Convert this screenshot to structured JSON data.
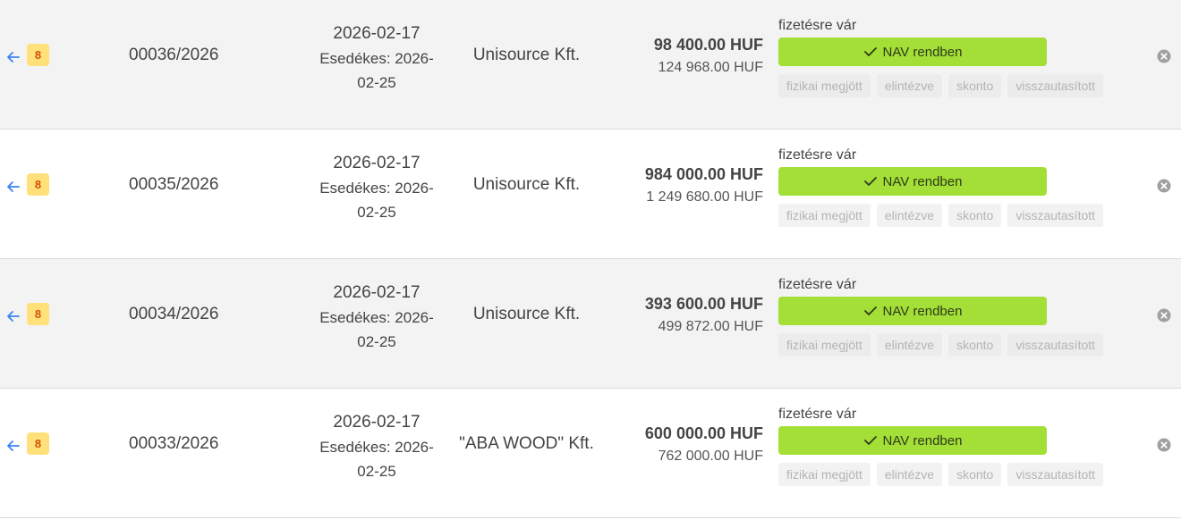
{
  "colors": {
    "badge_bg": "#ffe07a",
    "badge_text": "#d35400",
    "nav_ok": "#a3df36",
    "back_arrow": "#3b82f6",
    "remove_icon": "#a0a0a0"
  },
  "icons": {
    "back": "arrow-left-icon",
    "check": "check-icon",
    "remove": "close-circle-icon"
  },
  "rows": [
    {
      "badge": "8",
      "invoice_no": "00036/2026",
      "issue_date": "2026-02-17",
      "due": "Esedékes: 2026-02-25",
      "partner": "Unisource Kft.",
      "net": "98 400.00 HUF",
      "gross": "124 968.00 HUF",
      "payment_status": "fizetésre vár",
      "nav_status": "NAV rendben",
      "chips": [
        "fizikai megjött",
        "elintézve",
        "skonto",
        "visszautasított"
      ]
    },
    {
      "badge": "8",
      "invoice_no": "00035/2026",
      "issue_date": "2026-02-17",
      "due": "Esedékes: 2026-02-25",
      "partner": "Unisource Kft.",
      "net": "984 000.00 HUF",
      "gross": "1 249 680.00 HUF",
      "payment_status": "fizetésre vár",
      "nav_status": "NAV rendben",
      "chips": [
        "fizikai megjött",
        "elintézve",
        "skonto",
        "visszautasított"
      ]
    },
    {
      "badge": "8",
      "invoice_no": "00034/2026",
      "issue_date": "2026-02-17",
      "due": "Esedékes: 2026-02-25",
      "partner": "Unisource Kft.",
      "net": "393 600.00 HUF",
      "gross": "499 872.00 HUF",
      "payment_status": "fizetésre vár",
      "nav_status": "NAV rendben",
      "chips": [
        "fizikai megjött",
        "elintézve",
        "skonto",
        "visszautasított"
      ]
    },
    {
      "badge": "8",
      "invoice_no": "00033/2026",
      "issue_date": "2026-02-17",
      "due": "Esedékes: 2026-02-25",
      "partner": "\"ABA WOOD\" Kft.",
      "net": "600 000.00 HUF",
      "gross": "762 000.00 HUF",
      "payment_status": "fizetésre vár",
      "nav_status": "NAV rendben",
      "chips": [
        "fizikai megjött",
        "elintézve",
        "skonto",
        "visszautasított"
      ]
    }
  ]
}
